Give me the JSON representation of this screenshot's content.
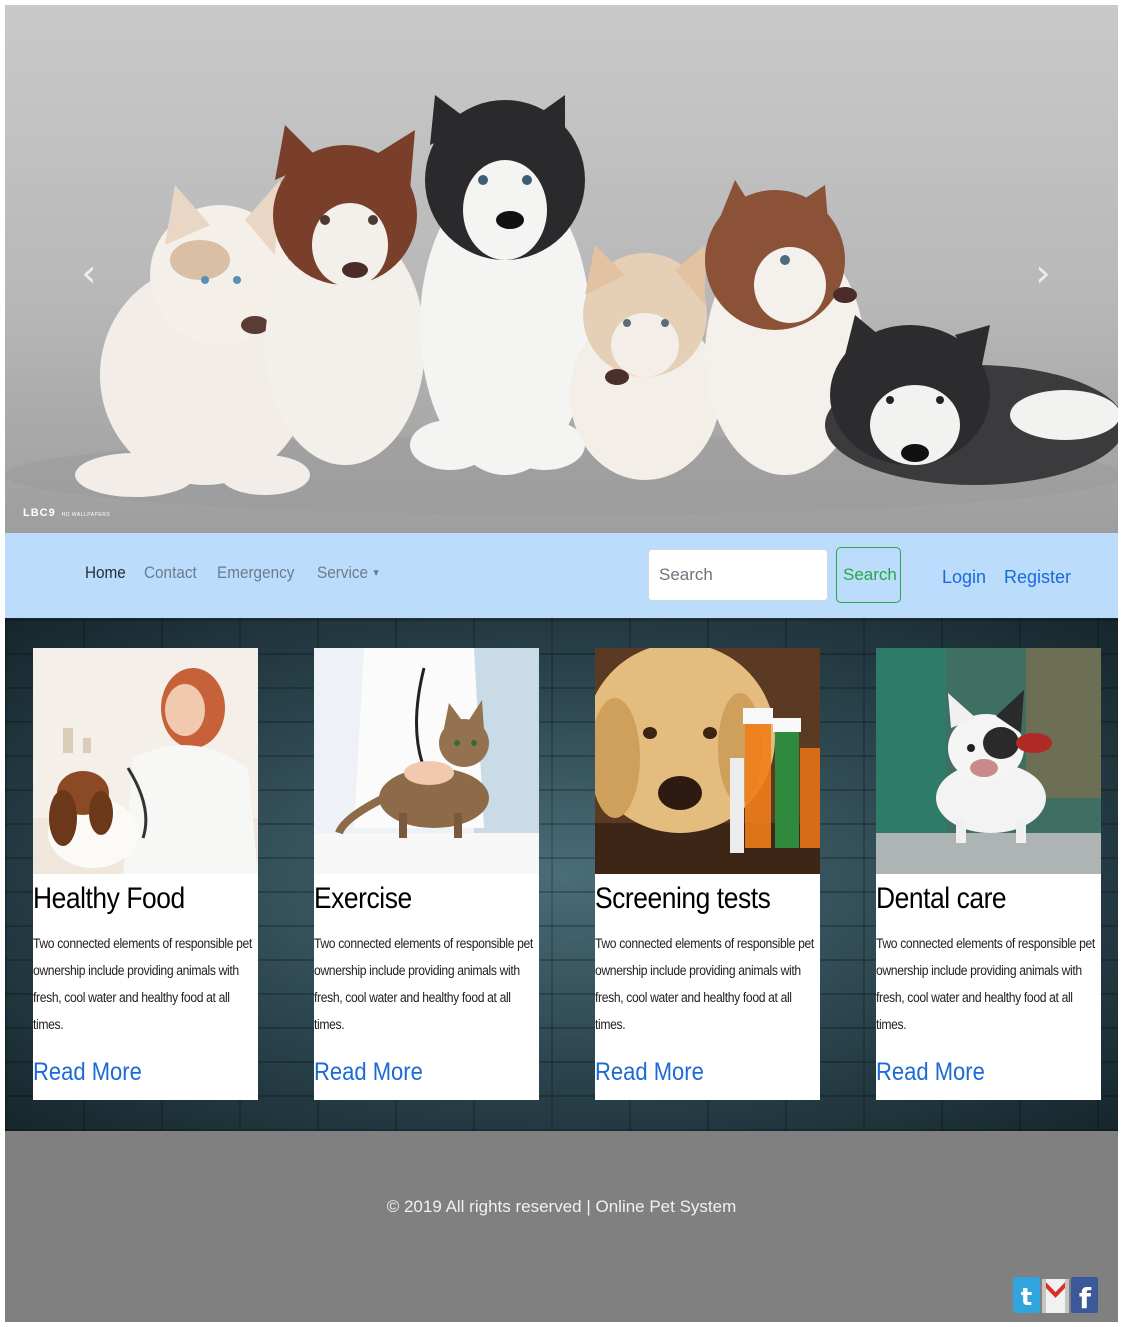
{
  "carousel": {
    "prev_glyph": "‹",
    "next_glyph": "›",
    "watermark": "LBC9",
    "watermark_sub": "HD WALLPAPERS"
  },
  "navbar": {
    "links": [
      {
        "label": "Home",
        "active": true
      },
      {
        "label": "Contact",
        "active": false
      },
      {
        "label": "Emergency",
        "active": false
      },
      {
        "label": "Service",
        "active": false,
        "dropdown": true
      }
    ],
    "search_placeholder": "Search",
    "search_button": "Search",
    "login": "Login",
    "register": "Register",
    "background": "#bbdcfb"
  },
  "services": {
    "cards": [
      {
        "title": "Healthy Food",
        "text": "Two connected elements of responsible pet ownership include providing animals with fresh, cool water and healthy food at all times.",
        "link": "Read More",
        "image": "vet-with-spaniel"
      },
      {
        "title": "Exercise",
        "text": "Two connected elements of responsible pet ownership include providing animals with fresh, cool water and healthy food at all times.",
        "link": "Read More",
        "image": "vet-with-cat"
      },
      {
        "title": "Screening tests",
        "text": "Two connected elements of responsible pet ownership include providing animals with fresh, cool water and healthy food at all times.",
        "link": "Read More",
        "image": "labrador-with-pills"
      },
      {
        "title": "Dental care",
        "text": "Two connected elements of responsible pet ownership include providing animals with fresh, cool water and healthy food at all times.",
        "link": "Read More",
        "image": "bulldog-on-table"
      }
    ]
  },
  "footer": {
    "copyright": "© 2019 All rights reserved | Online Pet System",
    "social": [
      "twitter-icon",
      "gmail-icon",
      "facebook-icon"
    ],
    "background": "#808080"
  },
  "colors": {
    "link": "#1b6ad6",
    "success": "#28a745"
  }
}
